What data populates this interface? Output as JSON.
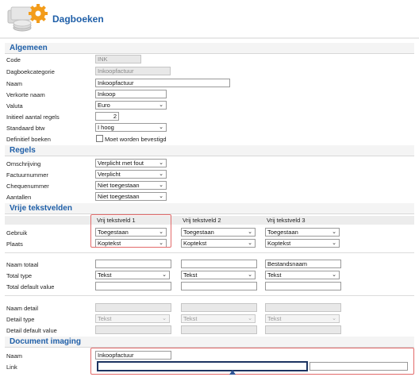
{
  "header": {
    "title": "Dagboeken",
    "logo_icon": "coins-gear-icon"
  },
  "sections": {
    "algemeen": "Algemeen",
    "regels": "Regels",
    "vrije": "Vrije tekstvelden",
    "docimg": "Document imaging"
  },
  "algemeen": {
    "code_label": "Code",
    "code_value": "INK",
    "categorie_label": "Dagboekcategorie",
    "categorie_value": "Inkoopfactuur",
    "naam_label": "Naam",
    "naam_value": "Inkoopfactuur",
    "verkorte_label": "Verkorte naam",
    "verkorte_value": "Inkoop",
    "valuta_label": "Valuta",
    "valuta_value": "Euro",
    "aantal_label": "Initieel aantal regels",
    "aantal_value": "2",
    "btw_label": "Standaard btw",
    "btw_value": "I hoog",
    "definitief_label": "Definitief boeken",
    "definitief_option": "Moet worden bevestigd"
  },
  "regels": {
    "omschrijving_label": "Omschrijving",
    "omschrijving_value": "Verplicht met fout",
    "factuur_label": "Factuurnummer",
    "factuur_value": "Verplicht",
    "cheque_label": "Chequenummer",
    "cheque_value": "Niet toegestaan",
    "aantallen_label": "Aantallen",
    "aantallen_value": "Niet toegestaan"
  },
  "vrije": {
    "columns": [
      "Vrij tekstveld 1",
      "Vrij tekstveld 2",
      "Vrij tekstveld 3"
    ],
    "gebruik_label": "Gebruik",
    "gebruik_values": [
      "Toegestaan",
      "Toegestaan",
      "Toegestaan"
    ],
    "plaats_label": "Plaats",
    "plaats_values": [
      "Koptekst",
      "Koptekst",
      "Koptekst"
    ],
    "naam_totaal_label": "Naam totaal",
    "naam_totaal_values": [
      "",
      "",
      "Bestandsnaam"
    ],
    "total_type_label": "Total type",
    "total_type_values": [
      "Tekst",
      "Tekst",
      "Tekst"
    ],
    "total_default_label": "Total default value",
    "naam_detail_label": "Naam detail",
    "detail_type_label": "Detail type",
    "detail_type_values": [
      "Tekst",
      "Tekst",
      "Tekst"
    ],
    "detail_default_label": "Detail default value"
  },
  "docimg": {
    "naam_label": "Naam",
    "naam_value": "Inkoopfactuur",
    "link_label": "Link",
    "link_value": ""
  }
}
